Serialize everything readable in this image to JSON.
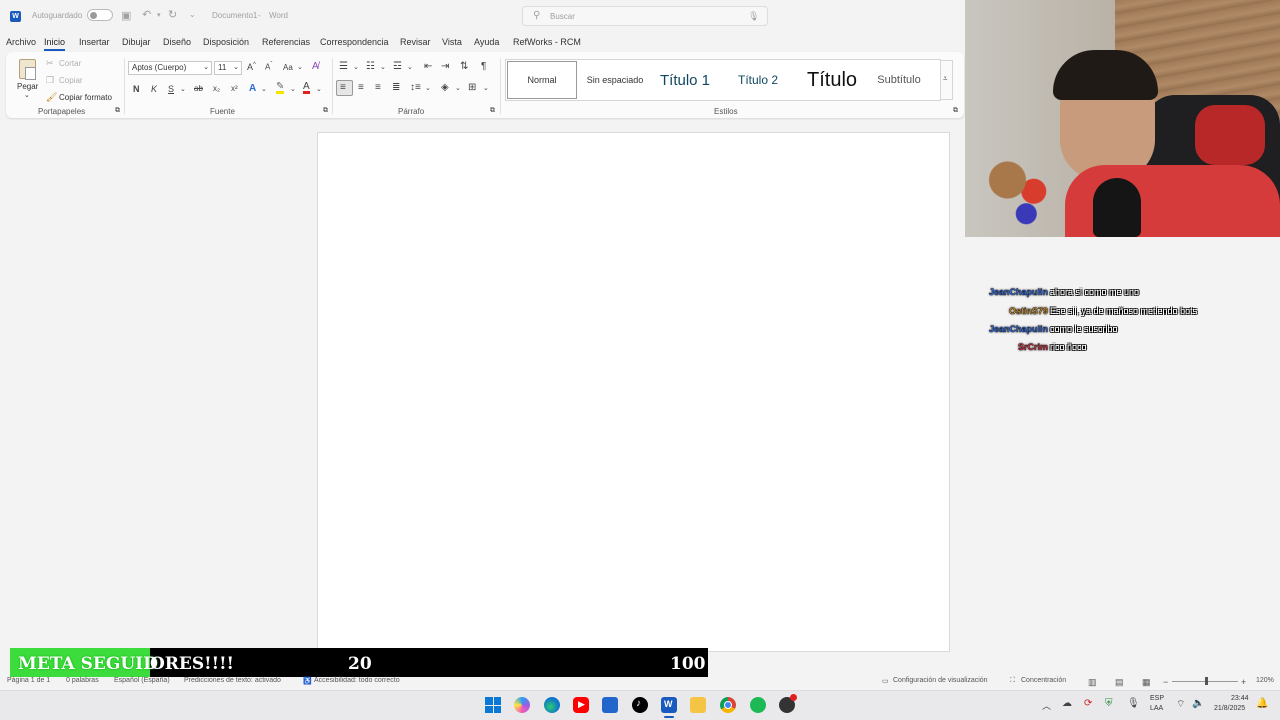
{
  "titlebar": {
    "autosave_label": "Autoguardado",
    "doc_title": "Documento1",
    "app_name": "Word",
    "search_placeholder": "Buscar"
  },
  "menu": {
    "tabs": [
      "Archivo",
      "Inicio",
      "Insertar",
      "Dibujar",
      "Diseño",
      "Disposición",
      "Referencias",
      "Correspondencia",
      "Revisar",
      "Vista",
      "Ayuda",
      "RefWorks - RCM"
    ],
    "active": "Inicio"
  },
  "ribbon": {
    "clipboard": {
      "paste": "Pegar",
      "cut": "Cortar",
      "copy": "Copiar",
      "format_painter": "Copiar formato",
      "label": "Portapapeles"
    },
    "font": {
      "name": "Aptos (Cuerpo)",
      "size": "11",
      "grow": "A^",
      "shrink": "Aˇ",
      "case": "Aa",
      "bold": "N",
      "italic": "K",
      "underline": "S",
      "strike": "ab",
      "sub": "x₂",
      "sup": "x²",
      "label": "Fuente"
    },
    "paragraph": {
      "label": "Párrafo"
    },
    "styles": {
      "items": [
        "Normal",
        "Sin espaciado",
        "Título 1",
        "Título 2",
        "Título",
        "Subtítulo"
      ],
      "label": "Estilos"
    }
  },
  "chat": [
    {
      "user": "JeanChapulin",
      "color": "#3b7cff",
      "message": "ahora si como me uno"
    },
    {
      "user": "OstinS79",
      "color": "#e8a33a",
      "message": "Ese sii, ya de mañoso metiendo bots"
    },
    {
      "user": "JeanChapulin",
      "color": "#3b7cff",
      "message": "como le suscribo"
    },
    {
      "user": "SrCrim",
      "color": "#e8374a",
      "message": "rico ñoco"
    }
  ],
  "goal": {
    "title_part1": "META SEGUID",
    "title_part2": "ORES!!!!",
    "current": "20",
    "target": "100",
    "progress": 0.2,
    "fill_color": "#3cdc3c"
  },
  "status": {
    "page": "Página 1 de 1",
    "words": "0 palabras",
    "language": "Español (España)",
    "predictions": "Predicciones de texto: activado",
    "accessibility": "Accesibilidad: todo correcto",
    "display_settings": "Configuración de visualización",
    "focus": "Concentración",
    "zoom": "120%"
  },
  "taskbar": {
    "lang_top": "ESP",
    "lang_bottom": "LAA",
    "time": "23:44",
    "date": "21/8/2025"
  }
}
